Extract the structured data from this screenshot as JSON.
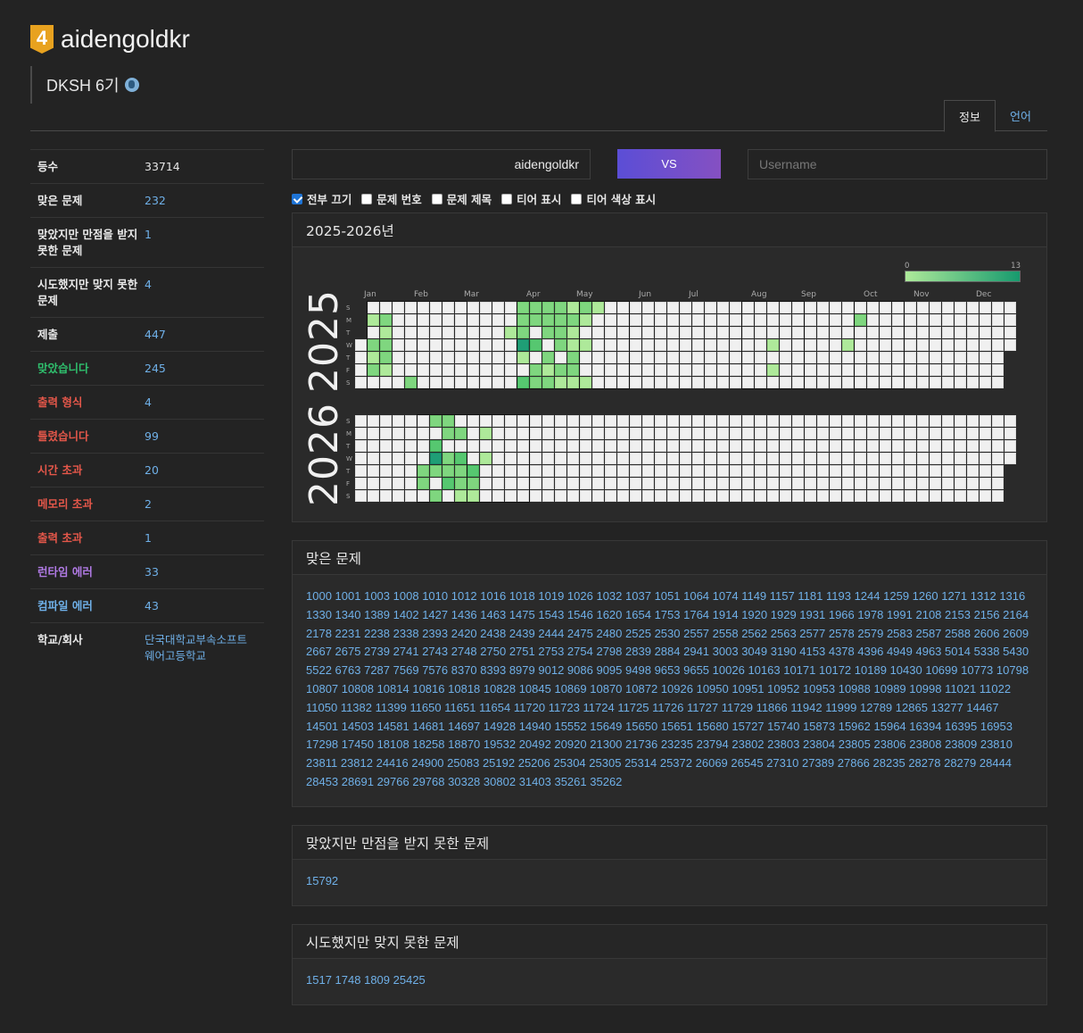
{
  "header": {
    "tier_badge": "4",
    "username": "aidengoldkr",
    "organization": "DKSH 6기"
  },
  "tabs": [
    {
      "label": "정보",
      "active": true
    },
    {
      "label": "언어",
      "active": false
    }
  ],
  "stats": [
    {
      "label": "등수",
      "value": "33714",
      "label_color": "default",
      "value_color": "plain"
    },
    {
      "label": "맞은 문제",
      "value": "232",
      "label_color": "default"
    },
    {
      "label": "맞았지만 만점을 받지 못한 문제",
      "value": "1",
      "label_color": "default"
    },
    {
      "label": "시도했지만 맞지 못한 문제",
      "value": "4",
      "label_color": "default"
    },
    {
      "label": "제출",
      "value": "447",
      "label_color": "default"
    },
    {
      "label": "맞았습니다",
      "value": "245",
      "label_color": "green"
    },
    {
      "label": "출력 형식",
      "value": "4",
      "label_color": "red"
    },
    {
      "label": "틀렸습니다",
      "value": "99",
      "label_color": "red"
    },
    {
      "label": "시간 초과",
      "value": "20",
      "label_color": "red"
    },
    {
      "label": "메모리 초과",
      "value": "2",
      "label_color": "red"
    },
    {
      "label": "출력 초과",
      "value": "1",
      "label_color": "red"
    },
    {
      "label": "런타임 에러",
      "value": "33",
      "label_color": "purple"
    },
    {
      "label": "컴파일 에러",
      "value": "43",
      "label_color": "blue"
    },
    {
      "label": "학교/회사",
      "value": "단국대학교부속소프트웨어고등학교",
      "label_color": "default"
    }
  ],
  "vs": {
    "left_user": "aidengoldkr",
    "button_label": "VS",
    "input_placeholder": "Username"
  },
  "options": [
    {
      "label": "전부 끄기",
      "checked": true
    },
    {
      "label": "문제 번호",
      "checked": false
    },
    {
      "label": "문제 제목",
      "checked": false
    },
    {
      "label": "티어 표시",
      "checked": false
    },
    {
      "label": "티어 색상 표시",
      "checked": false
    }
  ],
  "heatmap": {
    "title": "2025-2026년",
    "legend_min": "0",
    "legend_max": "13",
    "years": [
      "2025",
      "2026"
    ],
    "months": [
      "Jan",
      "Feb",
      "Mar",
      "Apr",
      "May",
      "Jun",
      "Jul",
      "Aug",
      "Sep",
      "Oct",
      "Nov",
      "Dec"
    ],
    "days": [
      "S",
      "M",
      "T",
      "W",
      "T",
      "F",
      "S"
    ],
    "colors": {
      "empty": "#f0f0f0",
      "low": "#aee99a",
      "high": "#1f9e76"
    }
  },
  "panels": {
    "solved_title": "맞은 문제",
    "solved": "1000 1001 1003 1008 1010 1012 1016 1018 1019 1026 1032 1037 1051 1064 1074 1149 1157 1181 1193 1244 1259 1260 1271 1312 1316 1330 1340 1389 1402 1427 1436 1463 1475 1543 1546 1620 1654 1753 1764 1914 1920 1929 1931 1966 1978 1991 2108 2153 2156 2164 2178 2231 2238 2338 2393 2420 2438 2439 2444 2475 2480 2525 2530 2557 2558 2562 2563 2577 2578 2579 2583 2587 2588 2606 2609 2667 2675 2739 2741 2743 2748 2750 2751 2753 2754 2798 2839 2884 2941 3003 3049 3190 4153 4378 4396 4949 4963 5014 5338 5430 5522 6763 7287 7569 7576 8370 8393 8979 9012 9086 9095 9498 9653 9655 10026 10163 10171 10172 10189 10430 10699 10773 10798 10807 10808 10814 10816 10818 10828 10845 10869 10870 10872 10926 10950 10951 10952 10953 10988 10989 10998 11021 11022 11050 11382 11399 11650 11651 11654 11720 11723 11724 11725 11726 11727 11729 11866 11942 11999 12789 12865 13277 14467 14501 14503 14581 14681 14697 14928 14940 15552 15649 15650 15651 15680 15727 15740 15873 15962 15964 16394 16395 16953 17298 17450 18108 18258 18870 19532 20492 20920 21300 21736 23235 23794 23802 23803 23804 23805 23806 23808 23809 23810 23811 23812 24416 24900 25083 25192 25206 25304 25305 25314 25372 26069 26545 27310 27389 27866 28235 28278 28279 28444 28453 28691 29766 29768 30328 30802 31403 35261 35262",
    "partial_title": "맞았지만 만점을 받지 못한 문제",
    "partial": "15792",
    "failed_title": "시도했지만 맞지 못한 문제",
    "failed": "1517 1748 1809 25425"
  }
}
